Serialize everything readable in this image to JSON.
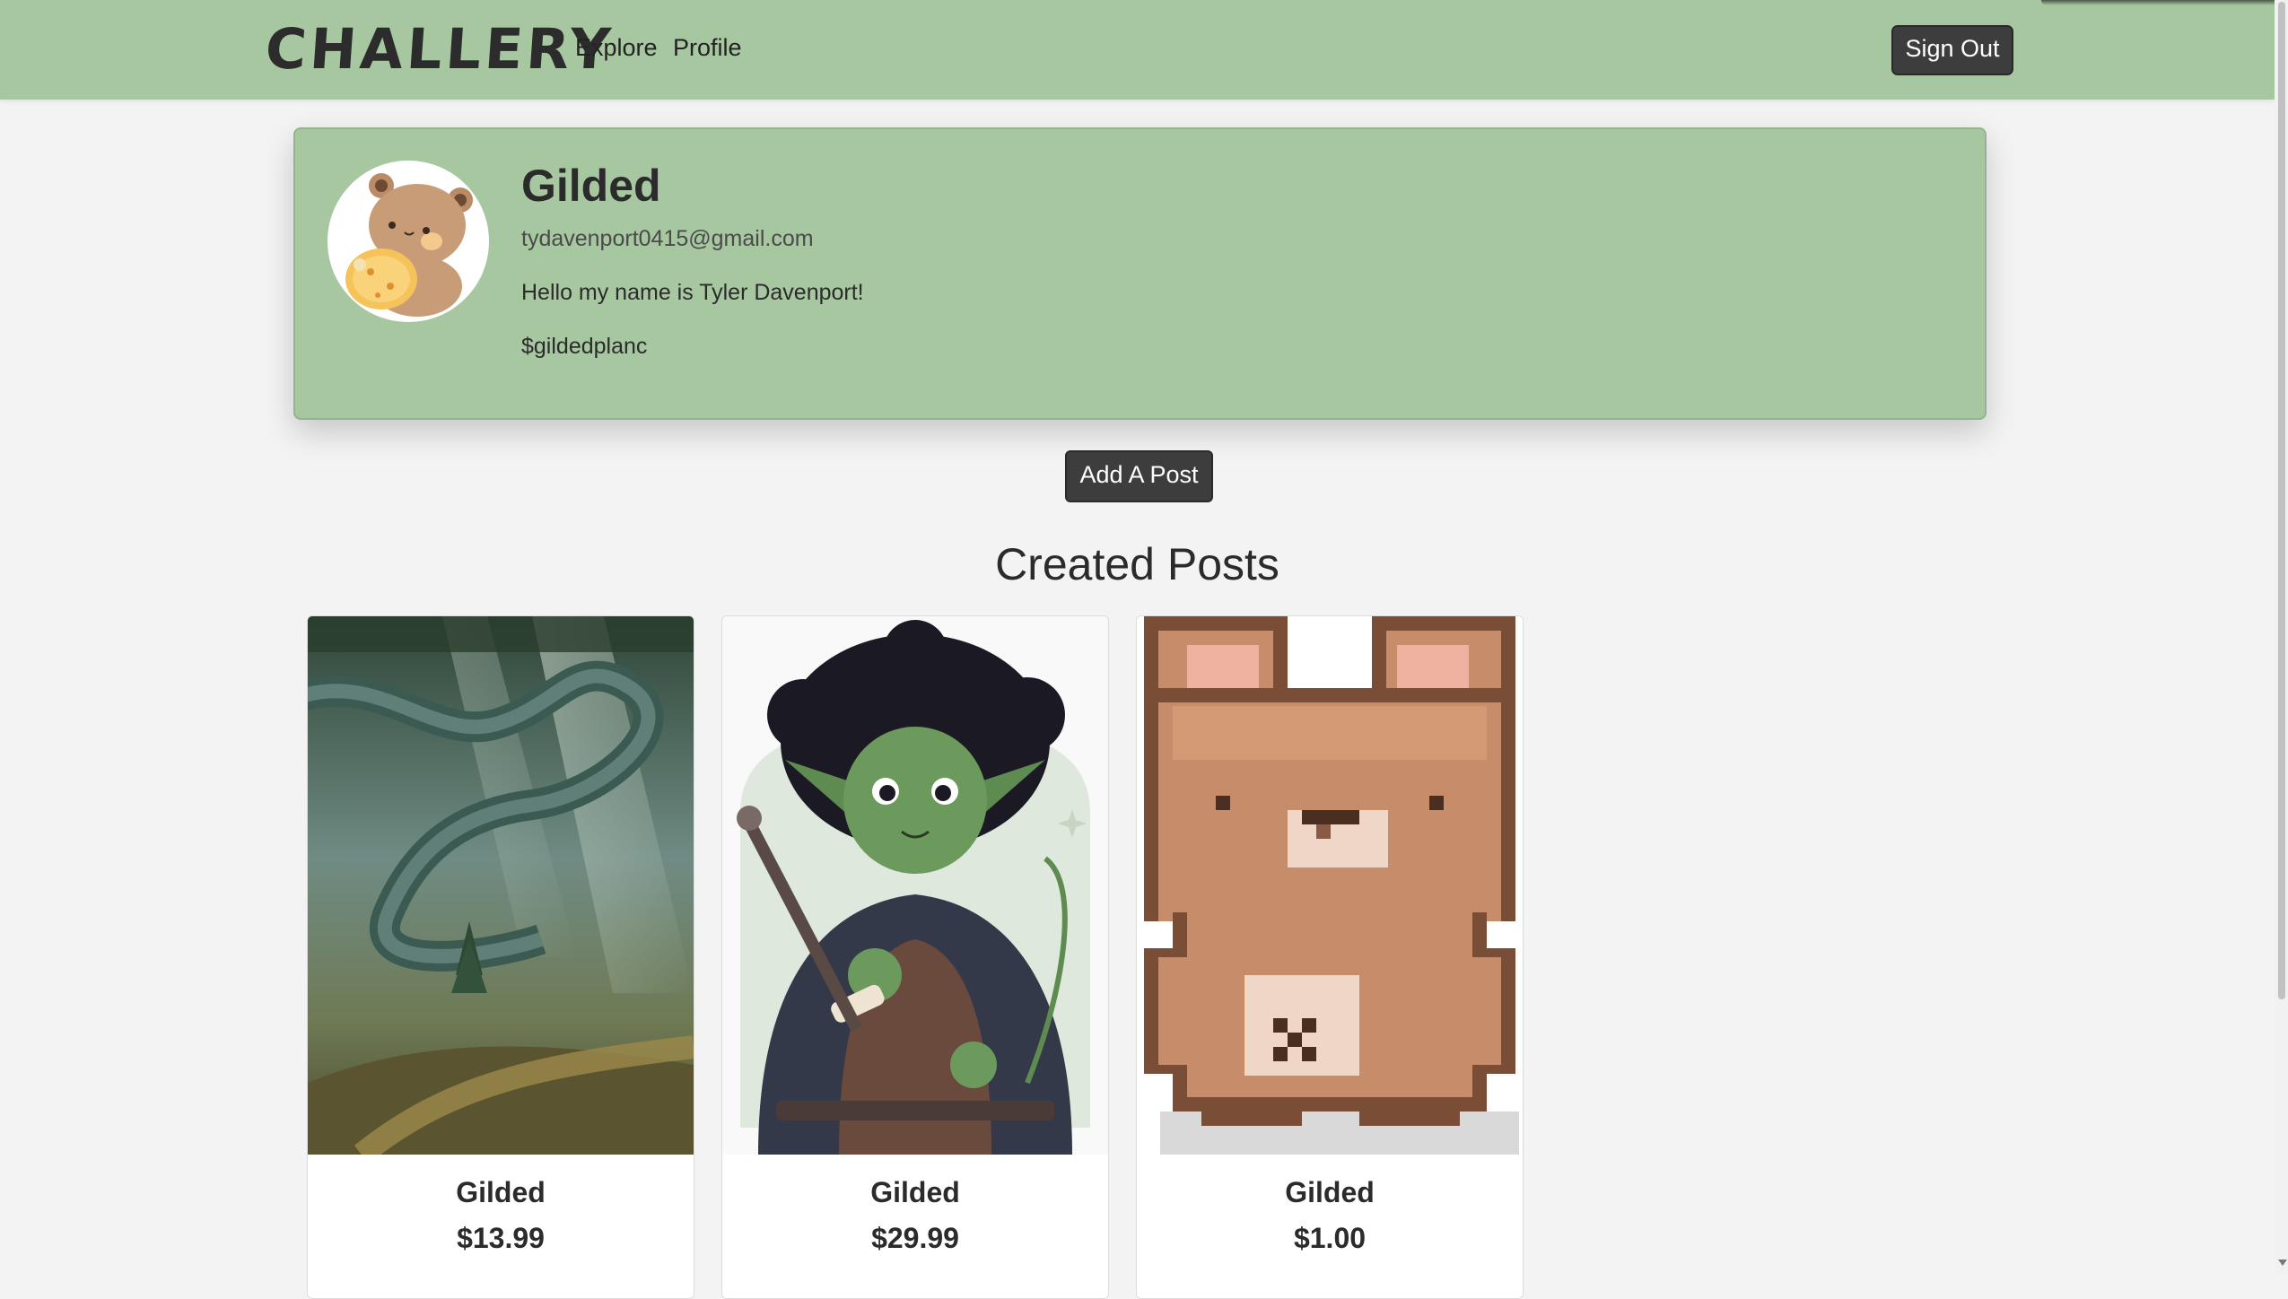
{
  "nav": {
    "brand": "CHALLERY",
    "links": [
      "Explore",
      "Profile"
    ],
    "signout_label": "Sign Out"
  },
  "profile": {
    "name": "Gilded",
    "email": "tydavenport0415@gmail.com",
    "bio": "Hello my name is Tyler Davenport!",
    "cashtag": "$gildedplanc",
    "avatar_icon": "bear-eating-cookie-icon"
  },
  "actions": {
    "add_post_label": "Add A Post"
  },
  "posts_section": {
    "title": "Created Posts",
    "posts": [
      {
        "title": "Gilded",
        "price": "$13.99",
        "image": "forest-painting-image"
      },
      {
        "title": "Gilded",
        "price": "$29.99",
        "image": "goblin-rogue-illustration"
      },
      {
        "title": "Gilded",
        "price": "$1.00",
        "image": "pixel-bear-image"
      }
    ]
  },
  "colors": {
    "nav_bg": "#a7c7a0",
    "page_bg": "#f3f3f3",
    "button_bg": "#3d3d3d"
  }
}
